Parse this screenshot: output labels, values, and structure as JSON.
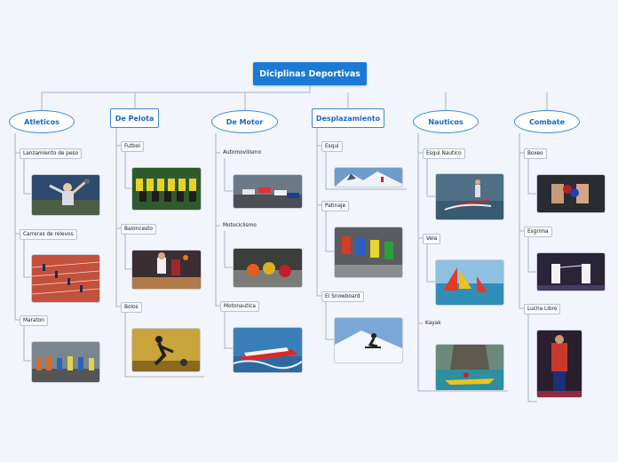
{
  "root": "Diciplinas Deportivas",
  "categories": [
    {
      "label": "Atleticos",
      "items": [
        "Lanzamiento de peso",
        "Carreras de relevos",
        "Maraton"
      ]
    },
    {
      "label": "De Pelota",
      "items": [
        "Futbol",
        "Baloncesto",
        "Bolos"
      ]
    },
    {
      "label": "De Motor",
      "items": [
        "Automovilismo",
        "Motociclismo",
        "Motonautica"
      ]
    },
    {
      "label": "Desplazamiento",
      "items": [
        "Esqui",
        "Patinaje",
        "El Snowboard"
      ]
    },
    {
      "label": "Nauticos",
      "items": [
        "Esqui Nautico",
        "Vela",
        "Kayak"
      ]
    },
    {
      "label": "Combate",
      "items": [
        "Boxeo",
        "Esgrima",
        "Lucha Libre"
      ]
    }
  ]
}
